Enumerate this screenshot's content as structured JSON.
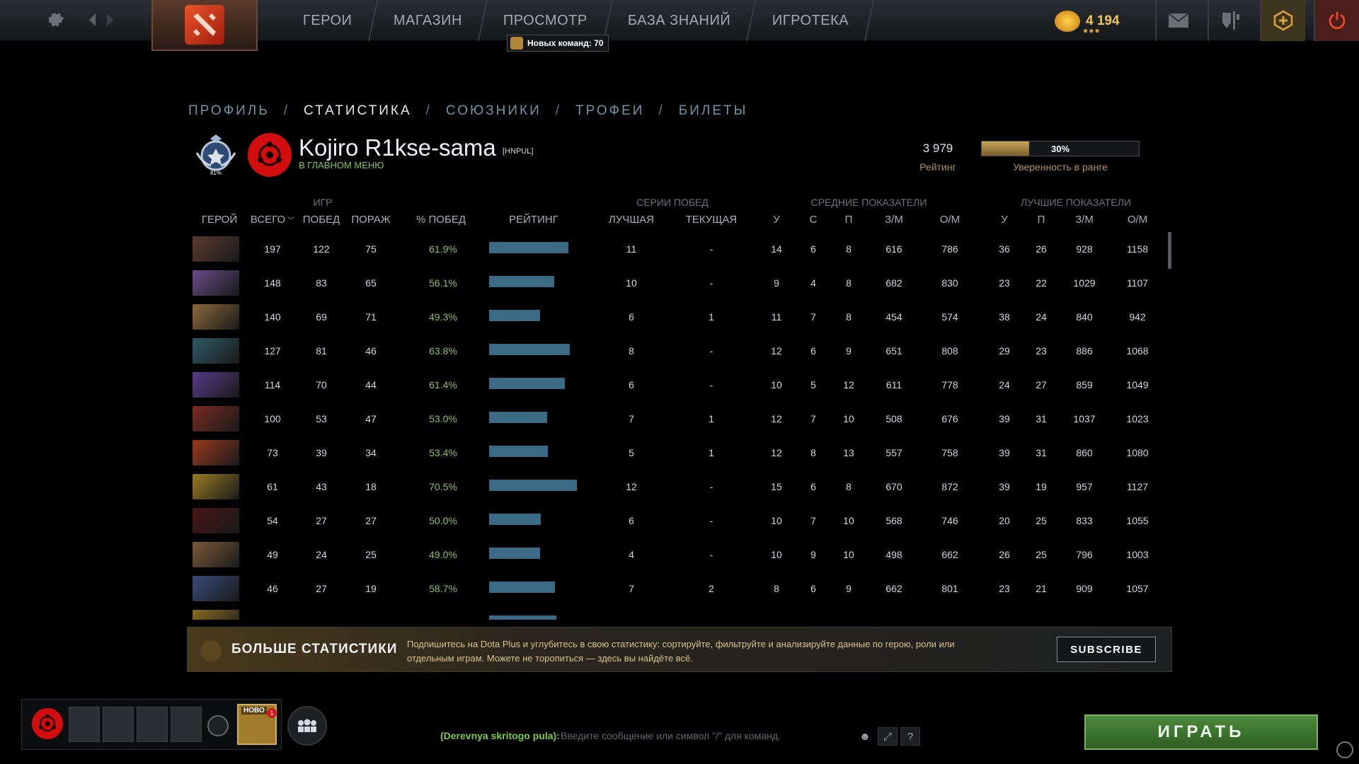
{
  "topbar": {
    "nav": [
      "ГЕРОИ",
      "МАГАЗИН",
      "ПРОСМОТР",
      "БАЗА ЗНАНИЙ",
      "ИГРОТЕКА"
    ],
    "notification": "Новых команд: 70",
    "shards": "4 194"
  },
  "profile_tabs": [
    {
      "label": "ПРОФИЛЬ",
      "active": false
    },
    {
      "label": "СТАТИСТИКА",
      "active": true
    },
    {
      "label": "СОЮЗНИКИ",
      "active": false
    },
    {
      "label": "ТРОФЕИ",
      "active": false
    },
    {
      "label": "БИЛЕТЫ",
      "active": false
    }
  ],
  "player": {
    "name": "Kojiro R1kse-sama",
    "tag": "[HNPUL]",
    "status": "В ГЛАВНОМ МЕНЮ",
    "rank_medal_number": "81%",
    "rating": "3 979",
    "rating_label": "Рейтинг",
    "confidence": 30,
    "confidence_text": "30%",
    "confidence_label": "Уверенность в ранге"
  },
  "table": {
    "groups": {
      "games": "ИГР",
      "streaks": "СЕРИИ ПОБЕД",
      "averages": "СРЕДНИЕ ПОКАЗАТЕЛИ",
      "bests": "ЛУЧШИЕ ПОКАЗАТЕЛИ"
    },
    "headers": {
      "hero": "ГЕРОЙ",
      "total": "ВСЕГО",
      "wins": "ПОБЕД",
      "losses": "ПОРАЖ",
      "winrate": "% ПОБЕД",
      "rating": "РЕЙТИНГ",
      "best": "ЛУЧШАЯ",
      "current": "ТЕКУЩАЯ",
      "avg_k": "У",
      "avg_d": "С",
      "avg_a": "П",
      "avg_xpm": "З/М",
      "avg_gpm": "О/М",
      "best_k": "У",
      "best_a": "П",
      "best_xpm": "З/М",
      "best_gpm": "О/М"
    },
    "rows": [
      {
        "total": "197",
        "wins": "122",
        "losses": "75",
        "winrate": "61.9%",
        "rating": 0.9,
        "best": "11",
        "current": "-",
        "ak": "14",
        "ad": "6",
        "aa": "8",
        "axpm": "616",
        "agpm": "786",
        "bk": "36",
        "ba": "26",
        "bxpm": "928",
        "bgpm": "1158",
        "color": "#5a3a2e"
      },
      {
        "total": "148",
        "wins": "83",
        "losses": "65",
        "winrate": "56.1%",
        "rating": 0.74,
        "best": "10",
        "current": "-",
        "ak": "9",
        "ad": "4",
        "aa": "8",
        "axpm": "682",
        "agpm": "830",
        "bk": "23",
        "ba": "22",
        "bxpm": "1029",
        "bgpm": "1107",
        "color": "#6a4a8a"
      },
      {
        "total": "140",
        "wins": "69",
        "losses": "71",
        "winrate": "49.3%",
        "rating": 0.58,
        "best": "6",
        "current": "1",
        "ak": "11",
        "ad": "7",
        "aa": "8",
        "axpm": "454",
        "agpm": "574",
        "bk": "38",
        "ba": "24",
        "bxpm": "840",
        "bgpm": "942",
        "color": "#8a6a3a"
      },
      {
        "total": "127",
        "wins": "81",
        "losses": "46",
        "winrate": "63.8%",
        "rating": 0.92,
        "best": "8",
        "current": "-",
        "ak": "12",
        "ad": "6",
        "aa": "9",
        "axpm": "651",
        "agpm": "808",
        "bk": "29",
        "ba": "23",
        "bxpm": "886",
        "bgpm": "1068",
        "color": "#2e5a66"
      },
      {
        "total": "114",
        "wins": "70",
        "losses": "44",
        "winrate": "61.4%",
        "rating": 0.86,
        "best": "6",
        "current": "-",
        "ak": "10",
        "ad": "5",
        "aa": "12",
        "axpm": "611",
        "agpm": "778",
        "bk": "24",
        "ba": "27",
        "bxpm": "859",
        "bgpm": "1049",
        "color": "#5a3a8a"
      },
      {
        "total": "100",
        "wins": "53",
        "losses": "47",
        "winrate": "53.0%",
        "rating": 0.66,
        "best": "7",
        "current": "1",
        "ak": "12",
        "ad": "7",
        "aa": "10",
        "axpm": "508",
        "agpm": "676",
        "bk": "39",
        "ba": "31",
        "bxpm": "1037",
        "bgpm": "1023",
        "color": "#7a2a22"
      },
      {
        "total": "73",
        "wins": "39",
        "losses": "34",
        "winrate": "53.4%",
        "rating": 0.67,
        "best": "5",
        "current": "1",
        "ak": "12",
        "ad": "8",
        "aa": "13",
        "axpm": "557",
        "agpm": "758",
        "bk": "39",
        "ba": "31",
        "bxpm": "860",
        "bgpm": "1080",
        "color": "#9a3a1e"
      },
      {
        "total": "61",
        "wins": "43",
        "losses": "18",
        "winrate": "70.5%",
        "rating": 1.0,
        "best": "12",
        "current": "-",
        "ak": "15",
        "ad": "6",
        "aa": "8",
        "axpm": "670",
        "agpm": "872",
        "bk": "39",
        "ba": "19",
        "bxpm": "957",
        "bgpm": "1127",
        "color": "#9a7a22"
      },
      {
        "total": "54",
        "wins": "27",
        "losses": "27",
        "winrate": "50.0%",
        "rating": 0.59,
        "best": "6",
        "current": "-",
        "ak": "10",
        "ad": "7",
        "aa": "10",
        "axpm": "568",
        "agpm": "746",
        "bk": "20",
        "ba": "25",
        "bxpm": "833",
        "bgpm": "1055",
        "color": "#4a1414"
      },
      {
        "total": "49",
        "wins": "24",
        "losses": "25",
        "winrate": "49.0%",
        "rating": 0.58,
        "best": "4",
        "current": "-",
        "ak": "10",
        "ad": "9",
        "aa": "10",
        "axpm": "498",
        "agpm": "662",
        "bk": "26",
        "ba": "25",
        "bxpm": "796",
        "bgpm": "1003",
        "color": "#7a5a3a"
      },
      {
        "total": "46",
        "wins": "27",
        "losses": "19",
        "winrate": "58.7%",
        "rating": 0.75,
        "best": "7",
        "current": "2",
        "ak": "8",
        "ad": "6",
        "aa": "9",
        "axpm": "662",
        "agpm": "801",
        "bk": "23",
        "ba": "21",
        "bxpm": "909",
        "bgpm": "1057",
        "color": "#3a4a7a"
      },
      {
        "total": "",
        "wins": "",
        "losses": "",
        "winrate": "",
        "rating": 0.77,
        "best": "",
        "current": "",
        "ak": "",
        "ad": "",
        "aa": "",
        "axpm": "",
        "agpm": "",
        "bk": "",
        "ba": "",
        "bxpm": "",
        "bgpm": "",
        "color": "#8a6a22"
      }
    ]
  },
  "plus_banner": {
    "title": "БОЛЬШЕ СТАТИСТИКИ",
    "description": "Подпишитесь на Dota Plus и углубитесь в свою статистику: сортируйте, фильтруйте и анализируйте данные по герою, роли или отдельным играм. Можете не торопиться — здесь вы найдёте всё.",
    "subscribe": "SUBSCRIBE"
  },
  "party": {
    "event_badge": "НОВО",
    "event_count": "1"
  },
  "chat": {
    "channel": "(Derevnya skritogo pula):",
    "placeholder": "Введите сообщение или символ \"/\" для команд."
  },
  "play_button": "ИГРАТЬ",
  "colors": {
    "winrate": "#8cc35b",
    "rating_bar": "#3b6a84",
    "status": "#7ecb41",
    "gold_label": "#b49255",
    "play": "#3f7a31"
  }
}
